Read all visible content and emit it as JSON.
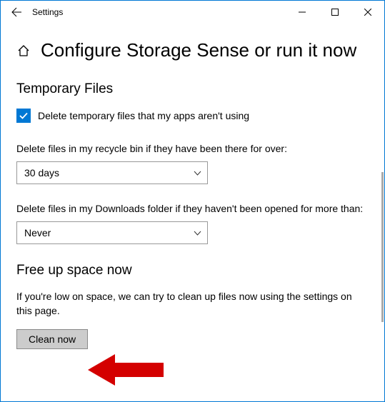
{
  "titlebar": {
    "app_name": "Settings"
  },
  "page": {
    "title": "Configure Storage Sense or run it now"
  },
  "temp_files": {
    "heading": "Temporary Files",
    "delete_unused_label": "Delete temporary files that my apps aren't using",
    "recycle_label": "Delete files in my recycle bin if they have been there for over:",
    "recycle_value": "30 days",
    "downloads_label": "Delete files in my Downloads folder if they haven't been opened for more than:",
    "downloads_value": "Never"
  },
  "free_up": {
    "heading": "Free up space now",
    "description": "If you're low on space, we can try to clean up files now using the settings on this page.",
    "button_label": "Clean now"
  }
}
